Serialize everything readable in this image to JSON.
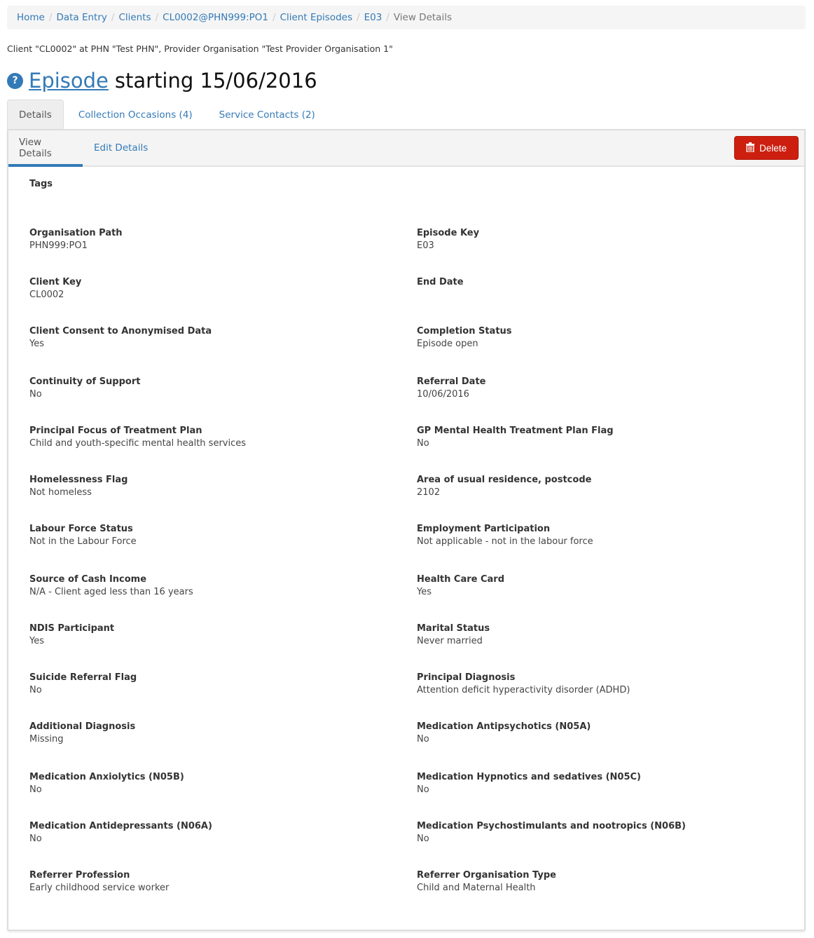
{
  "breadcrumb": {
    "items": [
      "Home",
      "Data Entry",
      "Clients",
      "CL0002@PHN999:PO1",
      "Client Episodes",
      "E03"
    ],
    "current": "View Details",
    "separator": "/"
  },
  "context_line": "Client \"CL0002\" at PHN \"Test PHN\", Provider Organisation \"Test Provider Organisation 1\"",
  "heading": {
    "help_icon": "?",
    "link_text": "Episode",
    "rest": "starting 15/06/2016"
  },
  "tabs": [
    {
      "label": "Details",
      "active": true
    },
    {
      "label": "Collection Occasions (4)",
      "active": false
    },
    {
      "label": "Service Contacts (2)",
      "active": false
    }
  ],
  "subnav": {
    "view_label": "View Details",
    "edit_label": "Edit Details",
    "delete_label": "Delete",
    "delete_icon": "trash-icon"
  },
  "colors": {
    "link": "#337ab7",
    "danger": "#cc1f0f"
  },
  "tags": {
    "label": "Tags",
    "value": ""
  },
  "fields": {
    "left": [
      {
        "label": "Organisation Path",
        "value": "PHN999:PO1"
      },
      {
        "label": "Client Key",
        "value": "CL0002"
      },
      {
        "label": "Client Consent to Anonymised Data",
        "value": "Yes"
      },
      {
        "label": "Continuity of Support",
        "value": "No"
      },
      {
        "label": "Principal Focus of Treatment Plan",
        "value": "Child and youth-specific mental health services"
      },
      {
        "label": "Homelessness Flag",
        "value": "Not homeless"
      },
      {
        "label": "Labour Force Status",
        "value": "Not in the Labour Force"
      },
      {
        "label": "Source of Cash Income",
        "value": "N/A - Client aged less than 16 years"
      },
      {
        "label": "NDIS Participant",
        "value": "Yes"
      },
      {
        "label": "Suicide Referral Flag",
        "value": "No"
      },
      {
        "label": "Additional Diagnosis",
        "value": "Missing"
      },
      {
        "label": "Medication Anxiolytics (N05B)",
        "value": "No"
      },
      {
        "label": "Medication Antidepressants (N06A)",
        "value": "No"
      },
      {
        "label": "Referrer Profession",
        "value": "Early childhood service worker"
      }
    ],
    "right": [
      {
        "label": "Episode Key",
        "value": "E03"
      },
      {
        "label": "End Date",
        "value": ""
      },
      {
        "label": "Completion Status",
        "value": "Episode open"
      },
      {
        "label": "Referral Date",
        "value": "10/06/2016"
      },
      {
        "label": "GP Mental Health Treatment Plan Flag",
        "value": "No"
      },
      {
        "label": "Area of usual residence, postcode",
        "value": "2102"
      },
      {
        "label": "Employment Participation",
        "value": "Not applicable - not in the labour force"
      },
      {
        "label": "Health Care Card",
        "value": "Yes"
      },
      {
        "label": "Marital Status",
        "value": "Never married"
      },
      {
        "label": "Principal Diagnosis",
        "value": "Attention deficit hyperactivity disorder (ADHD)"
      },
      {
        "label": "Medication Antipsychotics (N05A)",
        "value": "No"
      },
      {
        "label": "Medication Hypnotics and sedatives (N05C)",
        "value": "No"
      },
      {
        "label": "Medication Psychostimulants and nootropics (N06B)",
        "value": "No"
      },
      {
        "label": "Referrer Organisation Type",
        "value": "Child and Maternal Health"
      }
    ]
  }
}
